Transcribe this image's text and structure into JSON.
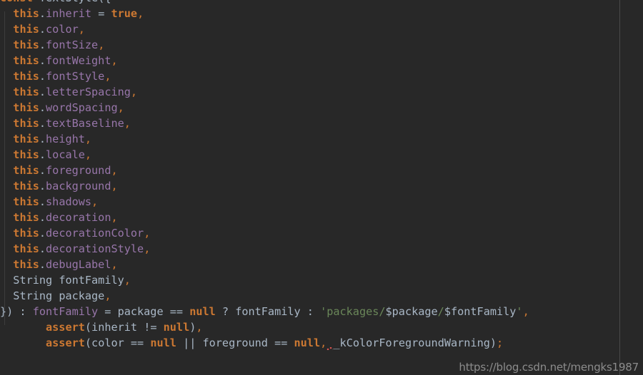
{
  "editor": {
    "background_color": "#282828",
    "ruler_color": "#4a4a4a",
    "indent_guide_color": "#3c3c3c",
    "language": "Dart",
    "colors": {
      "keyword": "#cc7832",
      "identifier": "#a9b7c6",
      "field": "#9876aa",
      "string": "#6a8759",
      "comment": "#629755",
      "error_squiggle": "#d9534f",
      "watermark": "#c9c9c9"
    }
  },
  "clipped_top_line": {
    "text": ""
  },
  "code": {
    "lines": [
      {
        "indent": "",
        "tokens": [
          {
            "text": "const",
            "type": "kw"
          },
          {
            "text": " ",
            "type": "plain"
          },
          {
            "text": "TextStyle",
            "type": "type"
          },
          {
            "text": "({",
            "type": "punc"
          }
        ]
      },
      {
        "indent": "  ",
        "tokens": [
          {
            "text": "this",
            "type": "kw"
          },
          {
            "text": ".",
            "type": "punc"
          },
          {
            "text": "inherit",
            "type": "field"
          },
          {
            "text": " = ",
            "type": "op"
          },
          {
            "text": "true",
            "type": "kw"
          },
          {
            "text": ",",
            "type": "comma"
          }
        ]
      },
      {
        "indent": "  ",
        "tokens": [
          {
            "text": "this",
            "type": "kw"
          },
          {
            "text": ".",
            "type": "punc"
          },
          {
            "text": "color",
            "type": "field"
          },
          {
            "text": ",",
            "type": "comma"
          }
        ]
      },
      {
        "indent": "  ",
        "tokens": [
          {
            "text": "this",
            "type": "kw"
          },
          {
            "text": ".",
            "type": "punc"
          },
          {
            "text": "fontSize",
            "type": "field"
          },
          {
            "text": ",",
            "type": "comma"
          }
        ]
      },
      {
        "indent": "  ",
        "tokens": [
          {
            "text": "this",
            "type": "kw"
          },
          {
            "text": ".",
            "type": "punc"
          },
          {
            "text": "fontWeight",
            "type": "field"
          },
          {
            "text": ",",
            "type": "comma"
          }
        ]
      },
      {
        "indent": "  ",
        "tokens": [
          {
            "text": "this",
            "type": "kw"
          },
          {
            "text": ".",
            "type": "punc"
          },
          {
            "text": "fontStyle",
            "type": "field"
          },
          {
            "text": ",",
            "type": "comma"
          }
        ]
      },
      {
        "indent": "  ",
        "tokens": [
          {
            "text": "this",
            "type": "kw"
          },
          {
            "text": ".",
            "type": "punc"
          },
          {
            "text": "letterSpacing",
            "type": "field"
          },
          {
            "text": ",",
            "type": "comma"
          }
        ]
      },
      {
        "indent": "  ",
        "tokens": [
          {
            "text": "this",
            "type": "kw"
          },
          {
            "text": ".",
            "type": "punc"
          },
          {
            "text": "wordSpacing",
            "type": "field"
          },
          {
            "text": ",",
            "type": "comma"
          }
        ]
      },
      {
        "indent": "  ",
        "tokens": [
          {
            "text": "this",
            "type": "kw"
          },
          {
            "text": ".",
            "type": "punc"
          },
          {
            "text": "textBaseline",
            "type": "field"
          },
          {
            "text": ",",
            "type": "comma"
          }
        ]
      },
      {
        "indent": "  ",
        "tokens": [
          {
            "text": "this",
            "type": "kw"
          },
          {
            "text": ".",
            "type": "punc"
          },
          {
            "text": "height",
            "type": "field"
          },
          {
            "text": ",",
            "type": "comma"
          }
        ]
      },
      {
        "indent": "  ",
        "tokens": [
          {
            "text": "this",
            "type": "kw"
          },
          {
            "text": ".",
            "type": "punc"
          },
          {
            "text": "locale",
            "type": "field"
          },
          {
            "text": ",",
            "type": "comma"
          }
        ]
      },
      {
        "indent": "  ",
        "tokens": [
          {
            "text": "this",
            "type": "kw"
          },
          {
            "text": ".",
            "type": "punc"
          },
          {
            "text": "foreground",
            "type": "field"
          },
          {
            "text": ",",
            "type": "comma"
          }
        ]
      },
      {
        "indent": "  ",
        "tokens": [
          {
            "text": "this",
            "type": "kw"
          },
          {
            "text": ".",
            "type": "punc"
          },
          {
            "text": "background",
            "type": "field"
          },
          {
            "text": ",",
            "type": "comma"
          }
        ]
      },
      {
        "indent": "  ",
        "tokens": [
          {
            "text": "this",
            "type": "kw"
          },
          {
            "text": ".",
            "type": "punc"
          },
          {
            "text": "shadows",
            "type": "field"
          },
          {
            "text": ",",
            "type": "comma"
          }
        ]
      },
      {
        "indent": "  ",
        "tokens": [
          {
            "text": "this",
            "type": "kw"
          },
          {
            "text": ".",
            "type": "punc"
          },
          {
            "text": "decoration",
            "type": "field"
          },
          {
            "text": ",",
            "type": "comma"
          }
        ]
      },
      {
        "indent": "  ",
        "tokens": [
          {
            "text": "this",
            "type": "kw"
          },
          {
            "text": ".",
            "type": "punc"
          },
          {
            "text": "decorationColor",
            "type": "field"
          },
          {
            "text": ",",
            "type": "comma"
          }
        ]
      },
      {
        "indent": "  ",
        "tokens": [
          {
            "text": "this",
            "type": "kw"
          },
          {
            "text": ".",
            "type": "punc"
          },
          {
            "text": "decorationStyle",
            "type": "field"
          },
          {
            "text": ",",
            "type": "comma"
          }
        ]
      },
      {
        "indent": "  ",
        "tokens": [
          {
            "text": "this",
            "type": "kw"
          },
          {
            "text": ".",
            "type": "punc"
          },
          {
            "text": "debugLabel",
            "type": "field"
          },
          {
            "text": ",",
            "type": "comma"
          }
        ]
      },
      {
        "indent": "  ",
        "tokens": [
          {
            "text": "String",
            "type": "type"
          },
          {
            "text": " fontFamily",
            "type": "plain"
          },
          {
            "text": ",",
            "type": "comma"
          }
        ]
      },
      {
        "indent": "  ",
        "tokens": [
          {
            "text": "String",
            "type": "type"
          },
          {
            "text": " package",
            "type": "plain"
          },
          {
            "text": ",",
            "type": "comma"
          }
        ]
      },
      {
        "indent": "",
        "tokens": [
          {
            "text": "}) : ",
            "type": "punc"
          },
          {
            "text": "fontFamily",
            "type": "field"
          },
          {
            "text": " = ",
            "type": "op"
          },
          {
            "text": "package",
            "type": "plain"
          },
          {
            "text": " == ",
            "type": "op"
          },
          {
            "text": "null",
            "type": "kw"
          },
          {
            "text": " ? ",
            "type": "op"
          },
          {
            "text": "fontFamily",
            "type": "plain"
          },
          {
            "text": " : ",
            "type": "op"
          },
          {
            "text": "'packages/",
            "type": "str"
          },
          {
            "text": "$package",
            "type": "interp"
          },
          {
            "text": "/",
            "type": "str"
          },
          {
            "text": "$fontFamily",
            "type": "interp"
          },
          {
            "text": "'",
            "type": "str"
          },
          {
            "text": ",",
            "type": "comma"
          }
        ]
      },
      {
        "indent": "       ",
        "tokens": [
          {
            "text": "assert",
            "type": "kw"
          },
          {
            "text": "(",
            "type": "punc"
          },
          {
            "text": "inherit",
            "type": "plain"
          },
          {
            "text": " != ",
            "type": "op"
          },
          {
            "text": "null",
            "type": "kw"
          },
          {
            "text": ")",
            "type": "punc"
          },
          {
            "text": ",",
            "type": "comma"
          }
        ]
      },
      {
        "indent": "       ",
        "tokens": [
          {
            "text": "assert",
            "type": "kw"
          },
          {
            "text": "(",
            "type": "punc"
          },
          {
            "text": "color",
            "type": "plain"
          },
          {
            "text": " == ",
            "type": "op"
          },
          {
            "text": "null",
            "type": "kw"
          },
          {
            "text": " || ",
            "type": "op"
          },
          {
            "text": "foreground",
            "type": "plain"
          },
          {
            "text": " == ",
            "type": "op"
          },
          {
            "text": "null",
            "type": "kw"
          },
          {
            "text": ",",
            "type": "comma"
          },
          {
            "text": " ",
            "type": "error"
          },
          {
            "text": "_kColorForegroundWarning",
            "type": "plain"
          },
          {
            "text": ")",
            "type": "punc"
          },
          {
            "text": ";",
            "type": "comma"
          }
        ]
      }
    ]
  },
  "watermark": {
    "text": "https://blog.csdn.net/mengks1987"
  }
}
